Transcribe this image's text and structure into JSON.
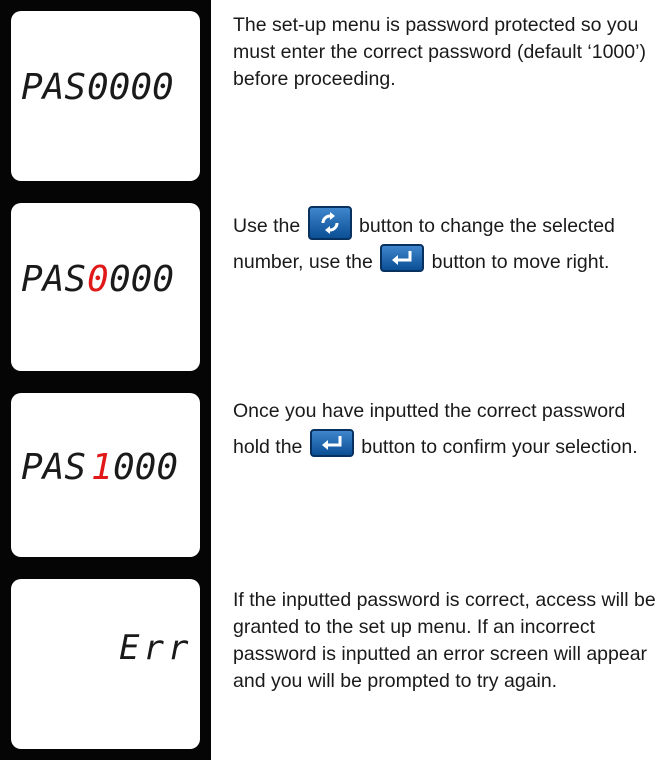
{
  "steps": [
    {
      "display": {
        "prefix": "PAS",
        "highlight": "",
        "digits": "0000"
      },
      "text": "The set-up menu is password protected so you must enter the correct password (default ‘1000’) before proceeding."
    },
    {
      "display": {
        "prefix": "PAS",
        "highlight": "0",
        "digits": "000"
      },
      "text_parts": [
        "Use the ",
        " button to change the selected number, use the ",
        " button to move right."
      ],
      "icons": [
        "rotate-icon",
        "enter-icon"
      ]
    },
    {
      "display": {
        "prefix": "PAS",
        "highlight": "1",
        "digits": "000"
      },
      "text_parts": [
        "Once you have inputted the correct password hold the ",
        " button to confirm your selection."
      ],
      "icons": [
        "enter-icon"
      ]
    },
    {
      "display": {
        "prefix": "",
        "highlight": "",
        "digits": "Err"
      },
      "text": "If the inputted password is correct, access will be granted to the set up menu. If an incorrect password is inputted an error screen will appear and you will be prompted to try again."
    }
  ],
  "colors": {
    "highlight": "#e01818",
    "segment": "#1a1a1a",
    "button": "#1a5fa8"
  }
}
